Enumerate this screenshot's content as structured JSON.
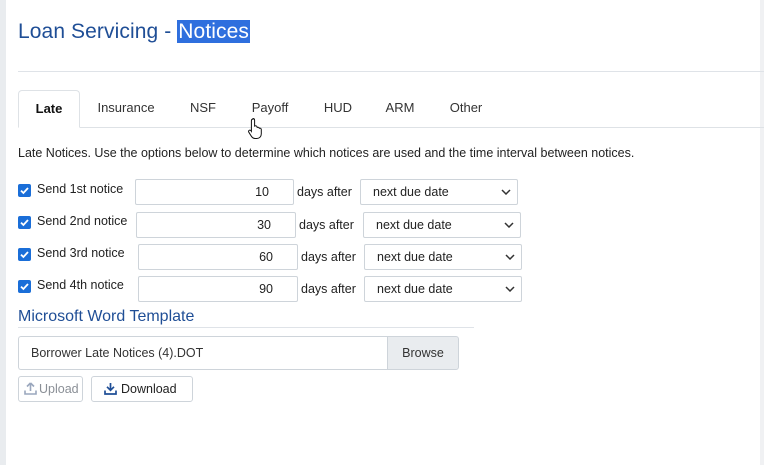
{
  "page": {
    "title_prefix": "Loan Servicing - ",
    "title_highlight": "Notices"
  },
  "tabs": [
    {
      "label": "Late",
      "active": true
    },
    {
      "label": "Insurance",
      "active": false
    },
    {
      "label": "NSF",
      "active": false
    },
    {
      "label": "Payoff",
      "active": false
    },
    {
      "label": "HUD",
      "active": false
    },
    {
      "label": "ARM",
      "active": false
    },
    {
      "label": "Other",
      "active": false
    }
  ],
  "late": {
    "intro": "Late Notices. Use the options below to determine which notices are used and the time interval between notices.",
    "days_after_label": "days after",
    "notices": [
      {
        "label": "Send 1st notice",
        "checked": true,
        "days": "10",
        "basis": "next due date"
      },
      {
        "label": "Send 2nd notice",
        "checked": true,
        "days": "30",
        "basis": "next due date"
      },
      {
        "label": "Send 3rd notice",
        "checked": true,
        "days": "60",
        "basis": "next due date"
      },
      {
        "label": "Send 4th notice",
        "checked": true,
        "days": "90",
        "basis": "next due date"
      }
    ]
  },
  "template": {
    "section_title": "Microsoft Word Template",
    "file_name": "Borrower Late Notices (4).DOT",
    "browse_label": "Browse",
    "upload_label": "Upload",
    "download_label": "Download"
  },
  "colors": {
    "accent": "#1f4e96",
    "checkbox": "#1a6ed8",
    "highlight": "#2f6fde"
  }
}
